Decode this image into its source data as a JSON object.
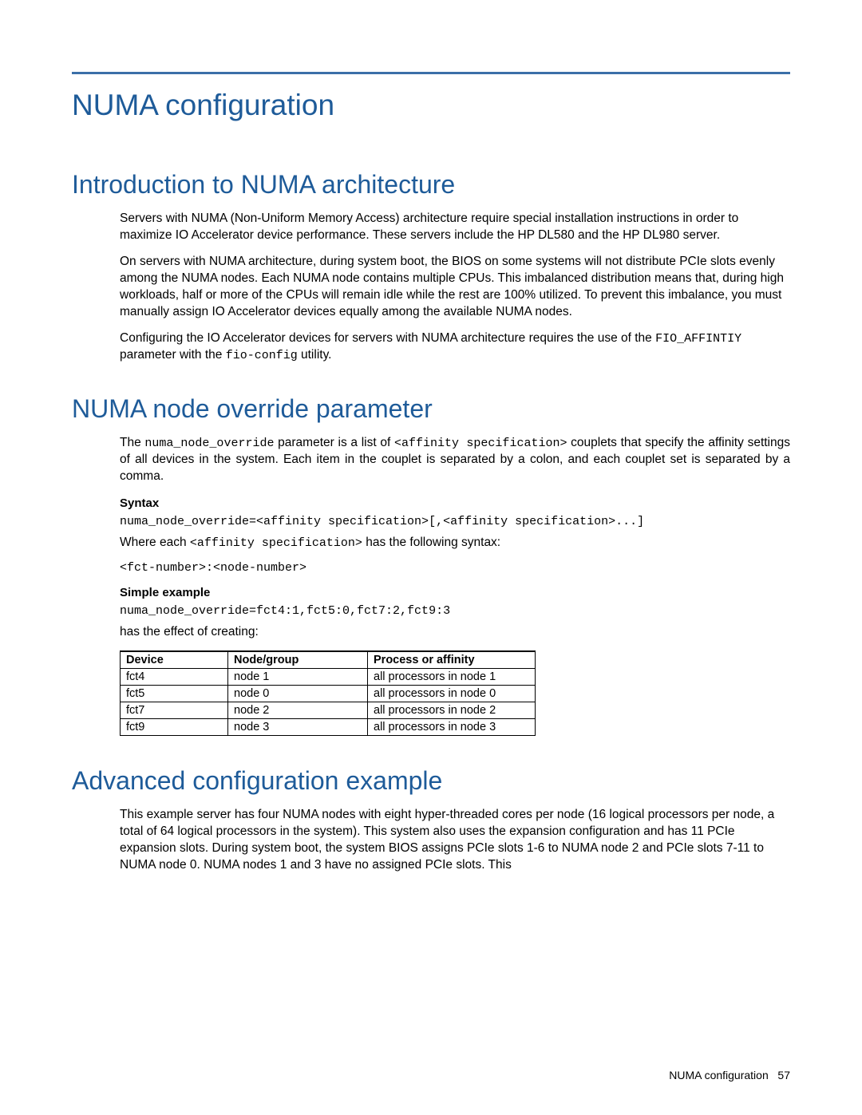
{
  "page": {
    "title": "NUMA configuration",
    "footer_label": "NUMA configuration",
    "footer_page": "57"
  },
  "sections": {
    "intro": {
      "title": "Introduction to NUMA architecture",
      "p1": "Servers with NUMA (Non-Uniform Memory Access) architecture require special installation instructions in order to maximize IO Accelerator device performance. These servers include the HP DL580 and the HP DL980 server.",
      "p2": "On servers with NUMA architecture, during system boot, the BIOS on some systems will not distribute PCIe slots evenly among the NUMA nodes. Each NUMA node contains multiple CPUs. This imbalanced distribution means that, during high workloads, half or more of the CPUs will remain idle while the rest are 100% utilized. To prevent this imbalance, you must manually assign IO Accelerator devices equally among the available NUMA nodes.",
      "p3_a": "Configuring the IO Accelerator devices for servers with NUMA architecture requires the use of the ",
      "p3_code1": "FIO_AFFINTIY",
      "p3_b": " parameter with the ",
      "p3_code2": "fio-config",
      "p3_c": " utility."
    },
    "override": {
      "title": "NUMA node override parameter",
      "p1_a": "The ",
      "p1_code1": "numa_node_override",
      "p1_b": " parameter is a list of ",
      "p1_code2": "<affinity specification>",
      "p1_c": " couplets that specify the affinity settings of all devices in the system. Each item in the couplet is separated by a colon, and each couplet set is separated by a comma.",
      "syntax_label": "Syntax",
      "syntax_line": "numa_node_override=<affinity specification>[,<affinity specification>...]",
      "where_a": "Where each ",
      "where_code": "<affinity specification>",
      "where_b": " has the following syntax:",
      "where_line": "<fct-number>:<node-number>",
      "example_label": "Simple example",
      "example_line": "numa_node_override=fct4:1,fct5:0,fct7:2,fct9:3",
      "effect_intro": "has the effect of creating:",
      "table": {
        "headers": [
          "Device",
          "Node/group",
          "Process or affinity"
        ],
        "rows": [
          [
            "fct4",
            "node 1",
            "all processors in node 1"
          ],
          [
            "fct5",
            "node 0",
            "all processors in node 0"
          ],
          [
            "fct7",
            "node 2",
            "all processors in node 2"
          ],
          [
            "fct9",
            "node 3",
            "all processors in node 3"
          ]
        ]
      }
    },
    "advanced": {
      "title": "Advanced configuration example",
      "p1": "This example server has four NUMA nodes with eight hyper-threaded cores per node (16 logical processors per node, a total of 64 logical processors in the system). This system also uses the expansion configuration and has 11 PCIe expansion slots. During system boot, the system BIOS assigns PCIe slots 1-6 to NUMA node 2 and PCIe slots 7-11 to NUMA node 0. NUMA nodes 1 and 3 have no assigned PCIe slots. This"
    }
  }
}
